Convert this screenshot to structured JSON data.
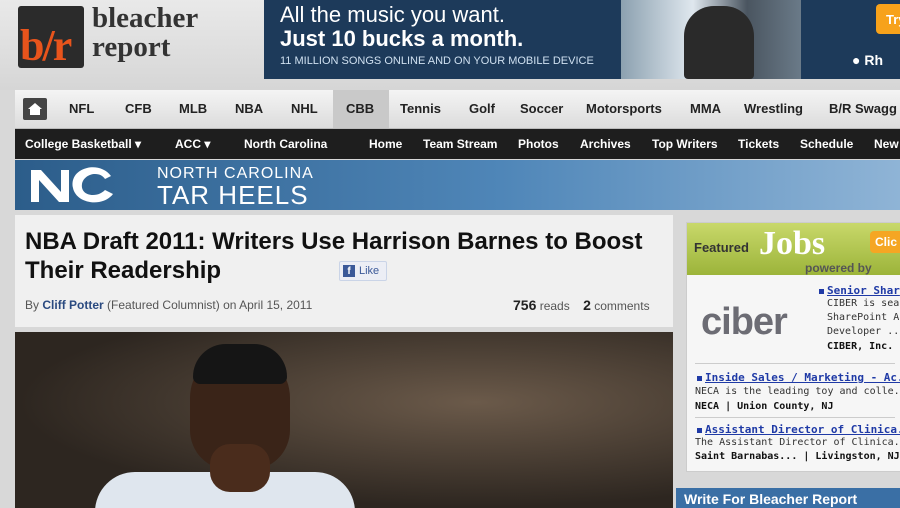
{
  "header": {
    "logo_mark": "b/r",
    "logo_line1": "bleacher",
    "logo_line2": "report"
  },
  "ad": {
    "headline1": "All the music you want.",
    "headline2": "Just 10 bucks a month.",
    "subline": "11 MILLION SONGS ONLINE AND ON YOUR MOBILE DEVICE",
    "try_label": "Try",
    "brand": "Rh"
  },
  "nav": {
    "items": [
      "NFL",
      "CFB",
      "MLB",
      "NBA",
      "NHL",
      "CBB",
      "Tennis",
      "Golf",
      "Soccer",
      "Motorsports",
      "MMA",
      "Wrestling",
      "B/R Swagg"
    ],
    "active": "CBB"
  },
  "subnav": {
    "items": [
      "College Basketball ▾",
      "ACC ▾",
      "North Carolina",
      "Home",
      "Team Stream",
      "Photos",
      "Archives",
      "Top Writers",
      "Tickets",
      "Schedule",
      "New"
    ]
  },
  "team": {
    "line1": "NORTH CAROLINA",
    "line2": "TAR HEELS"
  },
  "article": {
    "headline": "NBA Draft 2011: Writers Use Harrison Barnes to Boost Their Readership",
    "like_label": "Like",
    "by": "By",
    "author": "Cliff Potter",
    "role": "(Featured Columnist) on April 15, 2011",
    "reads_count": "756",
    "reads_label": "reads",
    "comments_count": "2",
    "comments_label": "comments"
  },
  "jobs": {
    "featured": "Featured",
    "big": "Jobs",
    "powered": "powered by",
    "click": "Clic",
    "logo": "ciber",
    "listings": [
      {
        "title": "Senior Shar",
        "desc1": "CIBER is searc",
        "desc2": "SharePoint Arc",
        "desc3": "Developer ...",
        "loc": "CIBER, Inc. |"
      },
      {
        "title": "Inside Sales / Marketing - Ac...",
        "desc1": "NECA is the leading toy and colle...",
        "loc": "NECA | Union County, NJ"
      },
      {
        "title": "Assistant Director of Clinica...",
        "desc1": "The Assistant Director of Clinica...",
        "loc": "Saint Barnabas... | Livingston, NJ"
      }
    ]
  },
  "write": {
    "label": "Write For Bleacher Report"
  }
}
